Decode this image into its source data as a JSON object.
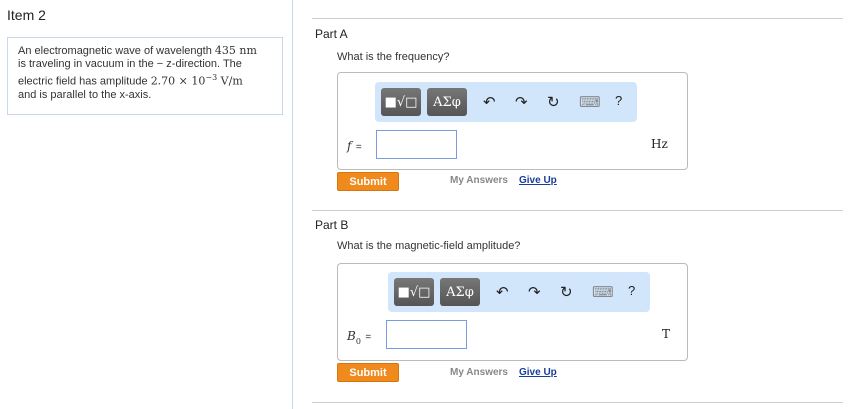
{
  "item_title": "Item 2",
  "problem": {
    "line1_pre": "An electromagnetic wave of wavelength ",
    "wavelength": "435 nm",
    "line2_pre": "is traveling in vacuum in the ",
    "direction_sign": "−",
    "line2_post": " z-direction. The",
    "line3_pre": "electric field has amplitude ",
    "amplitude": "2.70 × 10",
    "exp": "−3",
    "amp_unit": " V/m",
    "line4": "and is parallel to the x-axis."
  },
  "toolbar": {
    "templates": "■√□",
    "greek": "ΑΣφ",
    "undo": "↶",
    "redo": "↷",
    "reset": "↻",
    "keyboard": "⌨",
    "help": "?"
  },
  "parts": [
    {
      "title": "Part A",
      "question": "What is the frequency?",
      "var": "f",
      "eq": "=",
      "value": "",
      "unit": "Hz",
      "submit": "Submit",
      "my_answers": "My Answers",
      "give_up": "Give Up"
    },
    {
      "title": "Part B",
      "question": "What is the magnetic-field amplitude?",
      "var": "B",
      "var_sub": "0",
      "eq": "=",
      "value": "",
      "unit": "T",
      "submit": "Submit",
      "my_answers": "My Answers",
      "give_up": "Give Up"
    }
  ]
}
